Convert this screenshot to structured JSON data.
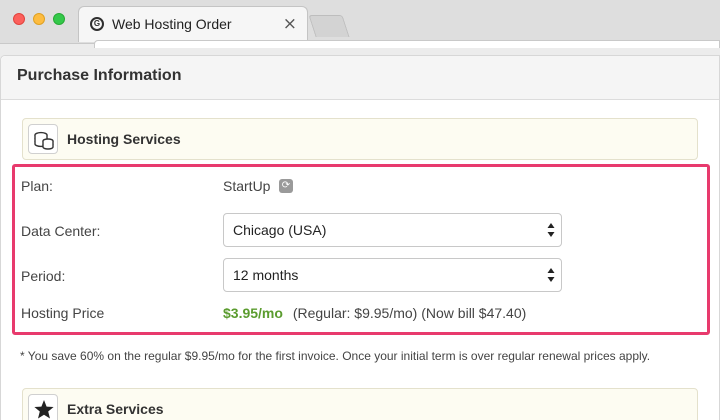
{
  "browser": {
    "tab_title": "Web Hosting Order",
    "favicon_letter": "G",
    "close_glyph": "×"
  },
  "page": {
    "title": "Purchase Information"
  },
  "hosting": {
    "section_title": "Hosting Services",
    "plan_label": "Plan:",
    "plan_value": "StartUp",
    "datacenter_label": "Data Center:",
    "datacenter_value": "Chicago (USA)",
    "period_label": "Period:",
    "period_value": "12 months",
    "price_label": "Hosting Price",
    "price_value": "$3.95/mo",
    "price_regular": "(Regular: $9.95/mo)",
    "price_bill": "(Now bill $47.40)",
    "highlight_color": "#e83a6d",
    "price_color": "#5b9c2f"
  },
  "note": "* You save 60% on the regular $9.95/mo for the first invoice. Once your initial term is over regular renewal prices apply.",
  "extra": {
    "section_title": "Extra Services"
  },
  "icons": {
    "hosting": "database-stack-icon",
    "extra": "star-icon",
    "plan_refresh": "refresh-icon",
    "select_arrows": "updown-arrows-icon"
  }
}
